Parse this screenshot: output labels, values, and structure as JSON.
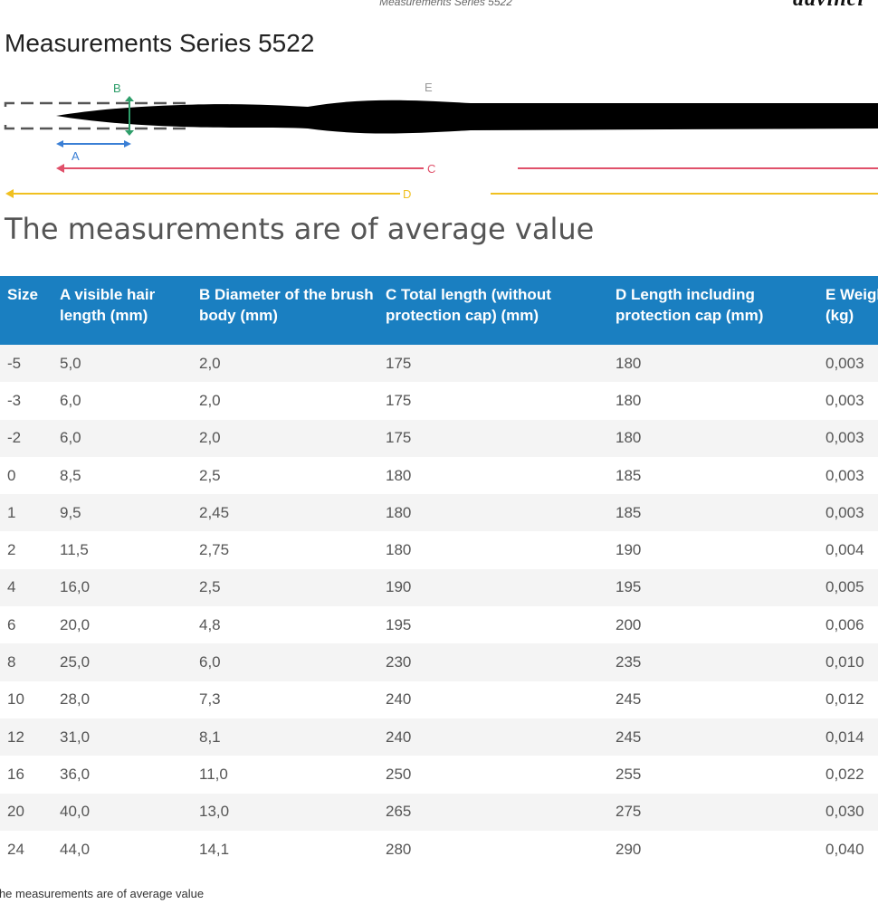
{
  "top_caption": "Measurements Series 5522",
  "brand": "davinci",
  "title": "Measurements Series 5522",
  "diagram": {
    "label_a": "A",
    "label_b": "B",
    "label_c": "C",
    "label_d": "D",
    "label_e": "E",
    "colors": {
      "a": "#3a7fd5",
      "b": "#2e9e6a",
      "c": "#e0506a",
      "d": "#f0c020"
    }
  },
  "subtitle": "The measurements are of average value",
  "table": {
    "headers": [
      "Size",
      "A visible hair length (mm)",
      "B Diameter of the brush body (mm)",
      "C Total length (without protection cap) (mm)",
      "D Length including protection cap (mm)",
      "E Weight (kg)"
    ],
    "rows": [
      [
        "-5",
        "5,0",
        "2,0",
        "175",
        "180",
        "0,003"
      ],
      [
        "-3",
        "6,0",
        "2,0",
        "175",
        "180",
        "0,003"
      ],
      [
        "-2",
        "6,0",
        "2,0",
        "175",
        "180",
        "0,003"
      ],
      [
        "0",
        "8,5",
        "2,5",
        "180",
        "185",
        "0,003"
      ],
      [
        "1",
        "9,5",
        "2,45",
        "180",
        "185",
        "0,003"
      ],
      [
        "2",
        "11,5",
        "2,75",
        "180",
        "190",
        "0,004"
      ],
      [
        "4",
        "16,0",
        "2,5",
        "190",
        "195",
        "0,005"
      ],
      [
        "6",
        "20,0",
        "4,8",
        "195",
        "200",
        "0,006"
      ],
      [
        "8",
        "25,0",
        "6,0",
        "230",
        "235",
        "0,010"
      ],
      [
        "10",
        "28,0",
        "7,3",
        "240",
        "245",
        "0,012"
      ],
      [
        "12",
        "31,0",
        "8,1",
        "240",
        "245",
        "0,014"
      ],
      [
        "16",
        "36,0",
        "11,0",
        "250",
        "255",
        "0,022"
      ],
      [
        "20",
        "40,0",
        "13,0",
        "265",
        "275",
        "0,030"
      ],
      [
        "24",
        "44,0",
        "14,1",
        "280",
        "290",
        "0,040"
      ]
    ]
  },
  "footnote": "The measurements are of average value"
}
